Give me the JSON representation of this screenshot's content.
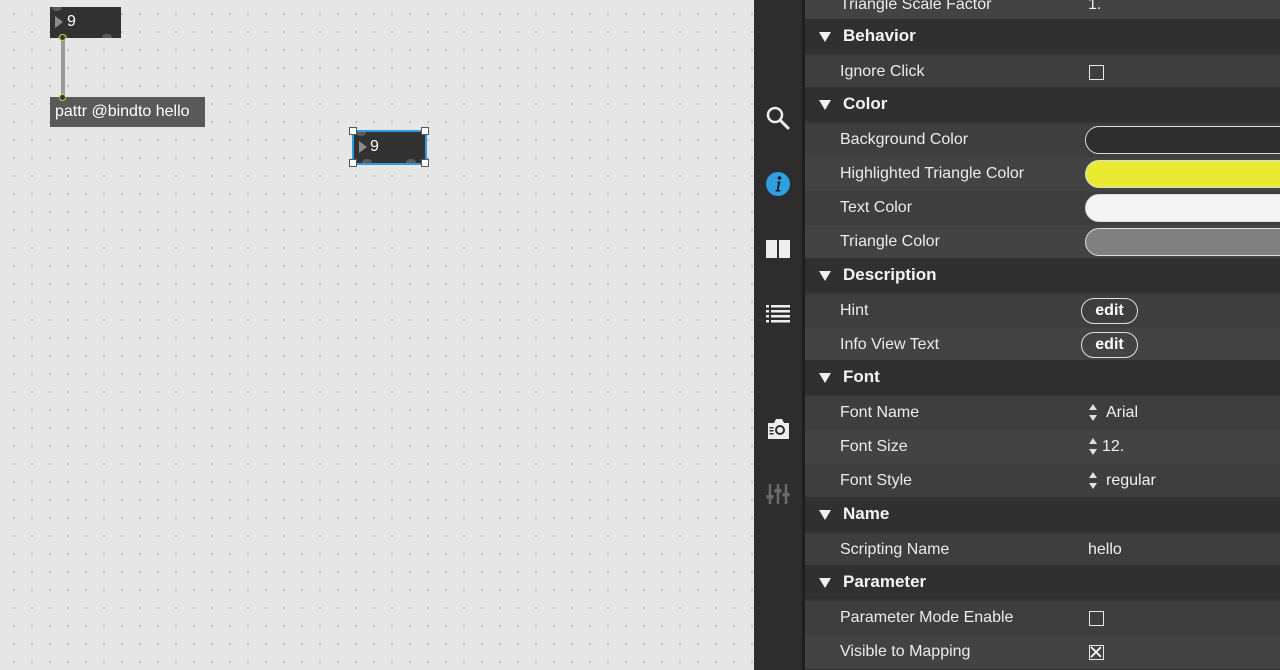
{
  "canvas": {
    "number_box_top": {
      "value": "9"
    },
    "number_box_selected": {
      "value": "9"
    },
    "pattr_object": {
      "text": "pattr @bindto hello"
    }
  },
  "rail": {
    "icons": [
      "search-icon",
      "info-icon",
      "columns-icon",
      "list-icon",
      "snapshot-camera-icon",
      "mixer-sliders-icon"
    ],
    "accent_color": "#2f9fe2"
  },
  "inspector": {
    "top_row": {
      "label": "Triangle Scale Factor",
      "value": "1."
    },
    "behavior": {
      "title": "Behavior",
      "ignore_click": {
        "label": "Ignore Click",
        "checked": false
      }
    },
    "color": {
      "title": "Color",
      "background_color": {
        "label": "Background Color",
        "swatch": "#2e2e2e"
      },
      "highlighted_triangle_color": {
        "label": "Highlighted Triangle Color",
        "swatch": "#eaea33"
      },
      "text_color": {
        "label": "Text Color",
        "swatch": "#f4f4f4"
      },
      "triangle_color": {
        "label": "Triangle Color",
        "swatch": "#808080"
      }
    },
    "description": {
      "title": "Description",
      "hint": {
        "label": "Hint",
        "button": "edit"
      },
      "info_view_text": {
        "label": "Info View Text",
        "button": "edit"
      }
    },
    "font": {
      "title": "Font",
      "font_name": {
        "label": "Font Name",
        "value": "Arial"
      },
      "font_size": {
        "label": "Font Size",
        "value": "12."
      },
      "font_style": {
        "label": "Font Style",
        "value": "regular"
      }
    },
    "name": {
      "title": "Name",
      "scripting_name": {
        "label": "Scripting Name",
        "value": "hello"
      }
    },
    "parameter": {
      "title": "Parameter",
      "parameter_mode_enable": {
        "label": "Parameter Mode Enable",
        "checked": false
      },
      "visible_to_mapping": {
        "label": "Visible to Mapping",
        "checked": true
      }
    }
  }
}
